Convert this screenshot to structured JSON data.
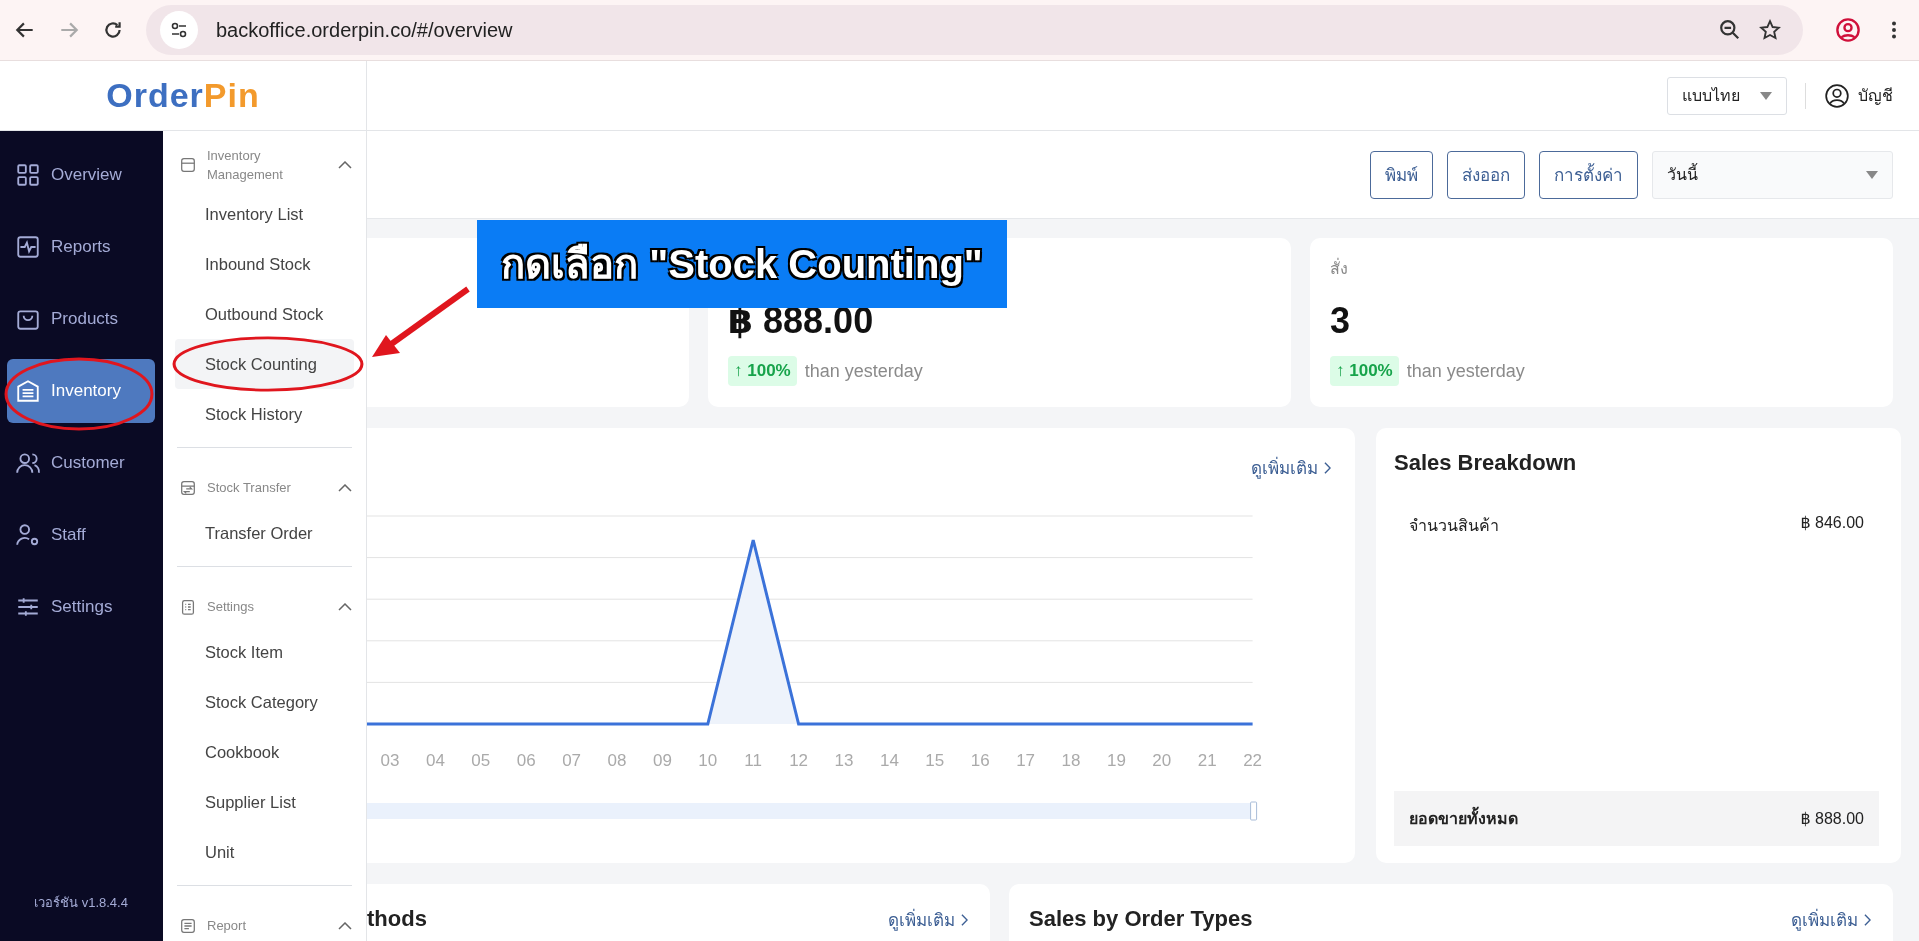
{
  "browser": {
    "url": "backoffice.orderpin.co/#/overview"
  },
  "header": {
    "logo": [
      {
        "text": "Order",
        "color": "#3d6fc1"
      },
      {
        "text": "Pin",
        "color": "#f39a2c"
      }
    ],
    "language_select": {
      "value": "แบบไทย"
    },
    "account": {
      "label": "บัญชี"
    }
  },
  "sidebar": {
    "items": [
      {
        "label": "Overview",
        "kind": "grid",
        "selected": false,
        "circled": false
      },
      {
        "label": "Reports",
        "kind": "pulse",
        "selected": false,
        "circled": false
      },
      {
        "label": "Products",
        "kind": "bag",
        "selected": false,
        "circled": false
      },
      {
        "label": "Inventory",
        "kind": "warehouse",
        "selected": true,
        "circled": true
      },
      {
        "label": "Customer",
        "kind": "users",
        "selected": false,
        "circled": false
      },
      {
        "label": "Staff",
        "kind": "user-gear",
        "selected": false,
        "circled": false
      },
      {
        "label": "Settings",
        "kind": "sliders",
        "selected": false,
        "circled": false
      }
    ],
    "version": "เวอร์ชัน v1.8.4.4"
  },
  "submenu": {
    "groups": [
      {
        "title": "Inventory Management",
        "kind": "box",
        "expanded": true,
        "items": [
          {
            "label": "Inventory List",
            "selected": false,
            "circled": false
          },
          {
            "label": "Inbound Stock",
            "selected": false,
            "circled": false
          },
          {
            "label": "Outbound Stock",
            "selected": false,
            "circled": false
          },
          {
            "label": "Stock Counting",
            "selected": true,
            "circled": true
          },
          {
            "label": "Stock History",
            "selected": false,
            "circled": false
          }
        ]
      },
      {
        "title": "Stock Transfer",
        "kind": "transfer",
        "expanded": true,
        "items": [
          {
            "label": "Transfer Order",
            "selected": false,
            "circled": false
          }
        ]
      },
      {
        "title": "Settings",
        "kind": "clipboard",
        "expanded": true,
        "items": [
          {
            "label": "Stock Item",
            "selected": false,
            "circled": false
          },
          {
            "label": "Stock Category",
            "selected": false,
            "circled": false
          },
          {
            "label": "Cookbook",
            "selected": false,
            "circled": false
          },
          {
            "label": "Supplier List",
            "selected": false,
            "circled": false
          },
          {
            "label": "Unit",
            "selected": false,
            "circled": false
          }
        ]
      },
      {
        "title": "Report",
        "kind": "list",
        "expanded": true
      }
    ]
  },
  "toolbar": {
    "buttons": [
      "พิมพ์",
      "ส่งออก",
      "การตั้งค่า"
    ],
    "period_select": {
      "value": "วันนี้"
    }
  },
  "stats": [
    {
      "value": "฿ 888.00",
      "change": "↑ 100%",
      "change_note": "than yesterday"
    },
    {
      "label": "สั่ง",
      "value": "3",
      "change": "↑ 100%",
      "change_note": "than yesterday"
    }
  ],
  "sales_chart": {
    "link": "ดูเพิ่มเติม",
    "range": {
      "level": 1
    },
    "x_labels": [
      "03",
      "04",
      "05",
      "06",
      "07",
      "08",
      "09",
      "10",
      "11",
      "12",
      "13",
      "14",
      "15",
      "16",
      "17",
      "18",
      "19",
      "20",
      "21",
      "22"
    ]
  },
  "sales_breakdown": {
    "title": "Sales Breakdown",
    "rows": [
      {
        "label": "จำนวนสินค้า",
        "value": "฿ 846.00"
      }
    ],
    "total": {
      "label": "ยอดขายทั้งหมด",
      "value": "฿ 888.00"
    }
  },
  "bottom_cards": [
    {
      "title": "thods",
      "link": "ดูเพิ่มเติม"
    },
    {
      "title": "Sales by Order Types",
      "link": "ดูเพิ่มเติม"
    }
  ],
  "annotation": {
    "text": "กดเลือก \"Stock Counting\""
  }
}
